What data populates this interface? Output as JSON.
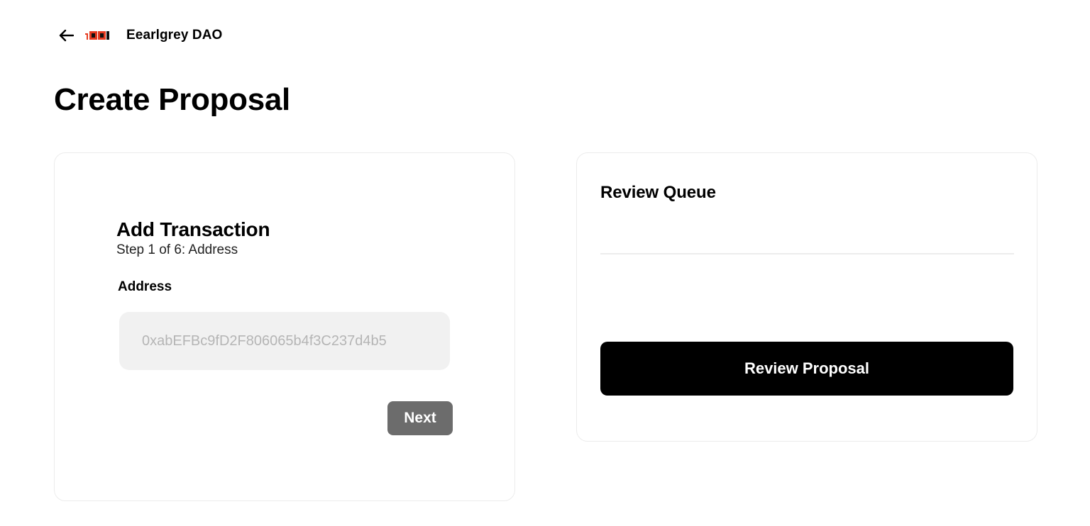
{
  "header": {
    "dao_name": "Eearlgrey DAO",
    "back_icon": "arrow-left-icon",
    "logo_icon": "dao-logo-icon",
    "logo_color": "#e53a1f"
  },
  "page": {
    "title": "Create Proposal"
  },
  "add_transaction": {
    "title": "Add Transaction",
    "step": "Step 1 of 6: Address",
    "address_label": "Address",
    "address_placeholder": "0xabEFBc9fD2F806065b4f3C237d4b5",
    "address_value": "",
    "next_label": "Next",
    "next_color": "#6c6c6c"
  },
  "review_queue": {
    "title": "Review Queue",
    "items": [],
    "review_button_label": "Review Proposal",
    "review_button_color": "#000000"
  }
}
